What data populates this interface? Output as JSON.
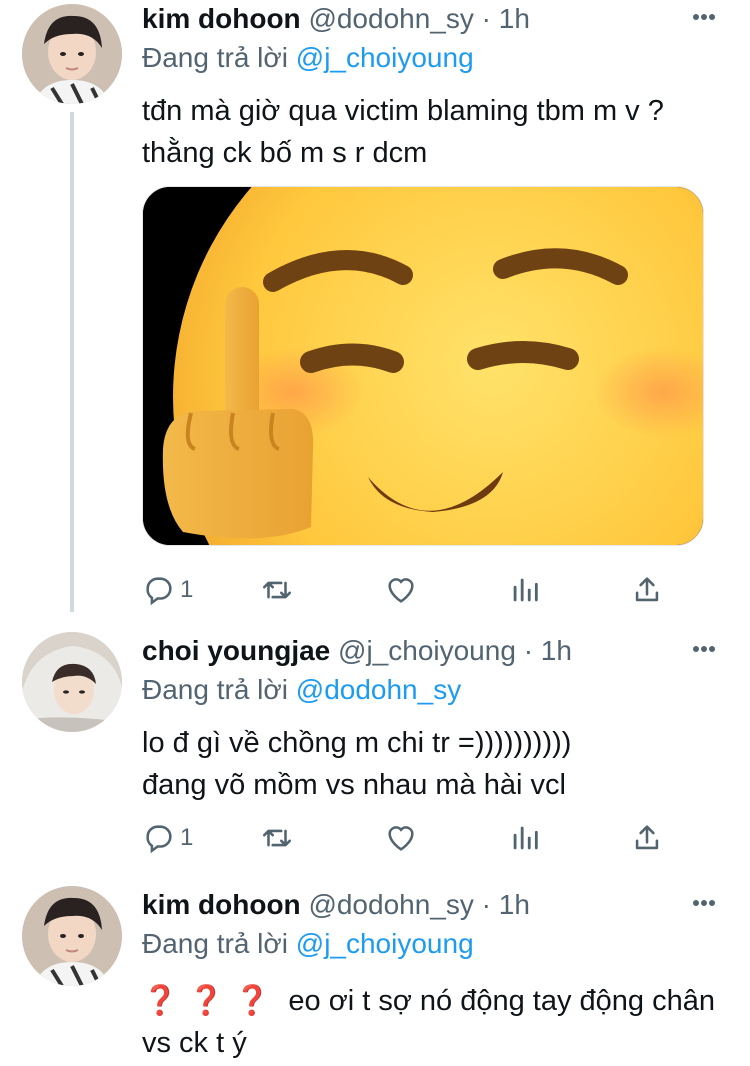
{
  "tweets": [
    {
      "name": "kim dohoon",
      "handle": "@dodohn_sy",
      "separator": "·",
      "time": "1h",
      "reply_prefix": "Đang trả lời",
      "reply_to": "@j_choiyoung",
      "text": "tđn mà giờ qua victim blaming tbm m v ? thằng ck bố m s r dcm",
      "media": "emoji-smiling-middle-finger",
      "reply_count": "1",
      "retweet_count": "",
      "like_count": ""
    },
    {
      "name": "choi youngjae",
      "handle": "@j_choiyoung",
      "separator": "·",
      "time": "1h",
      "reply_prefix": "Đang trả lời",
      "reply_to": "@dodohn_sy",
      "text_line1": "lo đ gì về chồng m chi tr =))))))))))",
      "text_line2": "đang võ mồm vs nhau mà hài vcl",
      "reply_count": "1",
      "retweet_count": "",
      "like_count": ""
    },
    {
      "name": "kim dohoon",
      "handle": "@dodohn_sy",
      "separator": "·",
      "time": "1h",
      "reply_prefix": "Đang trả lời",
      "reply_to": "@j_choiyoung",
      "question_marks": [
        "❓",
        "❓",
        "❓"
      ],
      "text": "eo ơi t sợ nó động tay động chân vs ck t ý"
    }
  ],
  "colors": {
    "link": "#1d9bf0",
    "secondary": "#536471",
    "thread_line": "#cfd9de",
    "question": "#e0245e"
  },
  "icons": [
    "reply-icon",
    "retweet-icon",
    "like-icon",
    "analytics-icon",
    "share-icon",
    "more-icon"
  ]
}
